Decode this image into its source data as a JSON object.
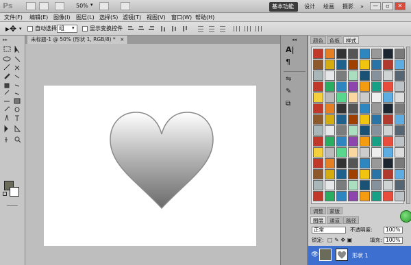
{
  "app": {
    "logo": "Ps",
    "zoom": "50%"
  },
  "workspaces": {
    "basic": "基本功能",
    "design": "设计",
    "painting": "绘画",
    "photography": "摄影",
    "more": "»"
  },
  "window_controls": {
    "minimize": "—",
    "maximize": "▫",
    "close": "✕"
  },
  "menu": [
    "文件(F)",
    "编辑(E)",
    "图像(I)",
    "图层(L)",
    "选择(S)",
    "滤镜(T)",
    "视图(V)",
    "窗口(W)",
    "帮助(H)"
  ],
  "options": {
    "auto_select_label": "自动选择:",
    "auto_select_value": "组",
    "show_transform_label": "显示变换控件"
  },
  "document": {
    "tab_label": "未标题-1 @ 50% (形状 1, RGB/8) *",
    "close": "×"
  },
  "styles_panel": {
    "tabs": [
      "颜色",
      "色板",
      "样式"
    ],
    "active_tab": "样式"
  },
  "layers_panel": {
    "top_tabs": [
      "调整",
      "蒙版"
    ],
    "tabs": [
      "图层",
      "通道",
      "路径"
    ],
    "blend_mode": "正常",
    "opacity_label": "不透明度:",
    "opacity_value": "100%",
    "lock_label": "锁定:",
    "fill_label": "填充:",
    "fill_value": "100%",
    "layer_name": "形状 1"
  },
  "colors": {
    "foreground": "#6b6b5a",
    "background": "#ffffff",
    "accent": "#3d6fd1"
  }
}
